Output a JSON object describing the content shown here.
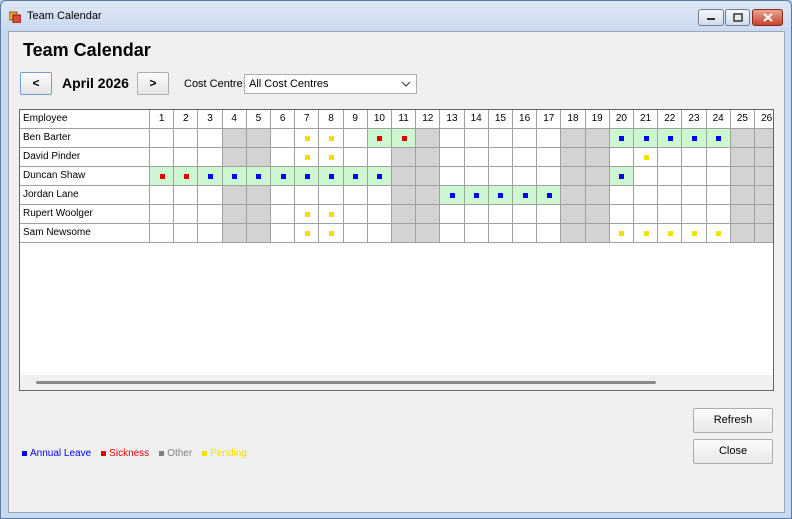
{
  "window": {
    "title": "Team Calendar"
  },
  "page": {
    "title": "Team Calendar",
    "month": "April 2026",
    "prev_label": "<",
    "next_label": ">",
    "cost_centre_label": "Cost Centre:",
    "cost_centre_value": "All Cost Centres"
  },
  "grid": {
    "employee_header": "Employee",
    "days": [
      "1",
      "2",
      "3",
      "4",
      "5",
      "6",
      "7",
      "8",
      "9",
      "10",
      "11",
      "12",
      "13",
      "14",
      "15",
      "16",
      "17",
      "18",
      "19",
      "20",
      "21",
      "22",
      "23",
      "24",
      "25",
      "26"
    ],
    "weekend_days": [
      4,
      5,
      11,
      12,
      18,
      19,
      25,
      26
    ],
    "employees": [
      {
        "name": "Ben Barter",
        "highlight": [
          10,
          11,
          20,
          21,
          22,
          23,
          24
        ],
        "marks": {
          "7": "pending",
          "8": "pending",
          "10": "sickness",
          "11": "sickness",
          "20": "annual",
          "21": "annual",
          "22": "annual",
          "23": "annual",
          "24": "annual"
        }
      },
      {
        "name": "David Pinder",
        "highlight": [],
        "marks": {
          "7": "pending",
          "8": "pending",
          "21": "pending"
        }
      },
      {
        "name": "Duncan Shaw",
        "highlight": [
          1,
          2,
          3,
          4,
          5,
          6,
          7,
          8,
          9,
          10,
          20
        ],
        "marks": {
          "1": "sickness",
          "2": "sickness",
          "3": "annual",
          "4": "annual",
          "5": "annual",
          "6": "annual",
          "7": "annual",
          "8": "annual",
          "9": "annual",
          "10": "annual",
          "20": "annual"
        }
      },
      {
        "name": "Jordan Lane",
        "highlight": [
          13,
          14,
          15,
          16,
          17
        ],
        "marks": {
          "13": "annual",
          "14": "annual",
          "15": "annual",
          "16": "annual",
          "17": "annual"
        }
      },
      {
        "name": "Rupert Woolger",
        "highlight": [],
        "marks": {
          "7": "pending",
          "8": "pending"
        }
      },
      {
        "name": "Sam Newsome",
        "highlight": [],
        "marks": {
          "7": "pending",
          "8": "pending",
          "20": "pending",
          "21": "pending",
          "22": "pending",
          "23": "pending",
          "24": "pending"
        }
      }
    ]
  },
  "colors": {
    "annual": "#0000ff",
    "sickness": "#e00000",
    "other": "#808080",
    "pending": "#f5e000"
  },
  "legend": [
    {
      "key": "annual",
      "label": "Annual Leave"
    },
    {
      "key": "sickness",
      "label": "Sickness"
    },
    {
      "key": "other",
      "label": "Other"
    },
    {
      "key": "pending",
      "label": "Pending"
    }
  ],
  "buttons": {
    "refresh": "Refresh",
    "close": "Close"
  }
}
